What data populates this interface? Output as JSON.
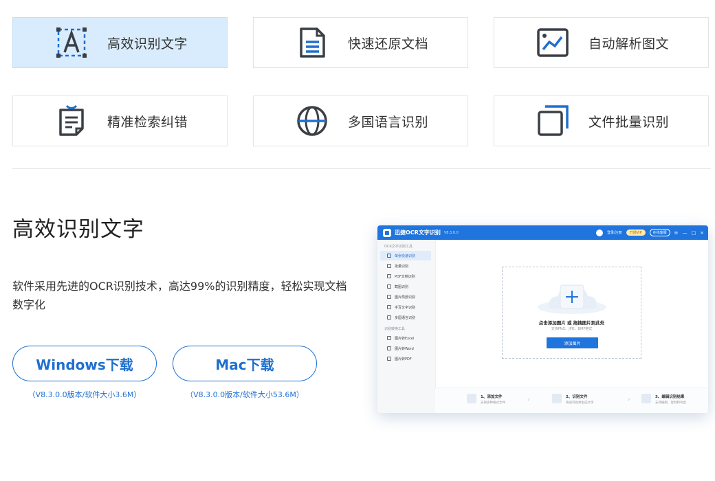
{
  "features": [
    {
      "label": "高效识别文字",
      "icon": "text-recognition-icon",
      "active": true
    },
    {
      "label": "快速还原文档",
      "icon": "document-icon",
      "active": false
    },
    {
      "label": "自动解析图文",
      "icon": "chart-image-icon",
      "active": false
    },
    {
      "label": "精准检索纠错",
      "icon": "proofread-doc-icon",
      "active": false
    },
    {
      "label": "多国语言识别",
      "icon": "globe-icon",
      "active": false
    },
    {
      "label": "文件批量识别",
      "icon": "batch-files-icon",
      "active": false
    }
  ],
  "section": {
    "title": "高效识别文字",
    "description": "软件采用先进的OCR识别技术，高达99%的识别精度，轻松实现文档数字化"
  },
  "downloads": [
    {
      "label": "Windows下载",
      "version": "（V8.3.0.0版本/软件大小3.6M）"
    },
    {
      "label": "Mac下载",
      "version": "（V8.3.0.0版本/软件大小53.6M）"
    }
  ],
  "app_preview": {
    "title": "迅捷OCR文字识别",
    "version": "V8.3.0.0",
    "login": "登录/注册",
    "vip": "开通VIP",
    "service": "在线客服",
    "window_controls": [
      "≡",
      "—",
      "□",
      "×"
    ],
    "sidebar_groups": [
      {
        "name": "OCR文字识别工具",
        "items": [
          "单张快速识别",
          "批量识别",
          "PDF文档识别",
          "截图识别",
          "图片局部识别",
          "手写文字识别",
          "多国语言识别"
        ]
      },
      {
        "name": "识别转换工具",
        "items": [
          "图片转Excel",
          "图片转Word",
          "图片转PDF"
        ]
      }
    ],
    "drop_title": "点击添加图片 或 拖拽图片到此处",
    "drop_hint": "支持PNG、JPG、BMP格式",
    "add_button": "添加图片",
    "steps": [
      {
        "title": "1、添加文件",
        "desc": "支持多种格式文件"
      },
      {
        "title": "2、识别文件",
        "desc": "快速识别并生成文字"
      },
      {
        "title": "3、编辑识别结果",
        "desc": "支持编辑、复制和导出"
      }
    ]
  },
  "colors": {
    "accent": "#1f6fd0",
    "active_card": "#d9ecfd",
    "icon_dark": "#3a3f46"
  }
}
